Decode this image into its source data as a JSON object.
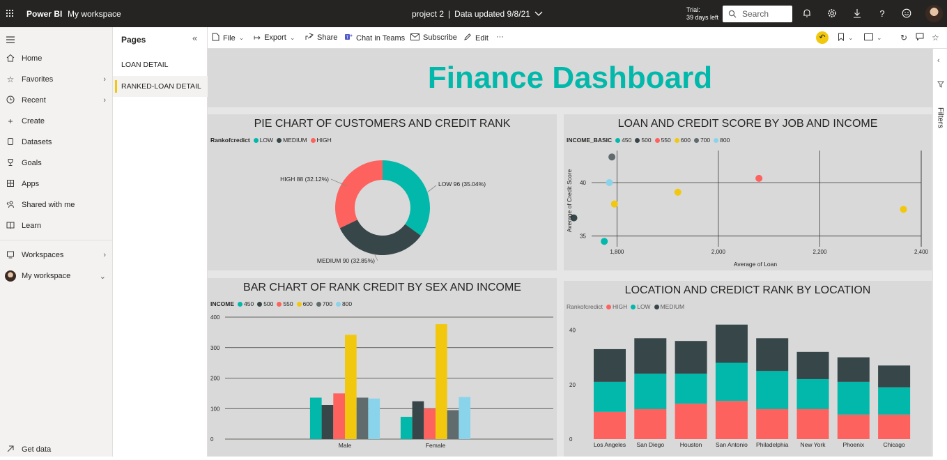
{
  "topbar": {
    "brand": "Power BI",
    "workspace": "My workspace",
    "report_name": "project 2",
    "separator": "|",
    "data_updated": "Data updated 9/8/21",
    "trial_line1": "Trial:",
    "trial_line2": "39 days left",
    "search_placeholder": "Search"
  },
  "nav": {
    "items": [
      {
        "label": "Home",
        "icon": "home-icon"
      },
      {
        "label": "Favorites",
        "icon": "star-icon"
      },
      {
        "label": "Recent",
        "icon": "clock-icon"
      },
      {
        "label": "Create",
        "icon": "plus-icon"
      },
      {
        "label": "Datasets",
        "icon": "database-icon"
      },
      {
        "label": "Goals",
        "icon": "trophy-icon"
      },
      {
        "label": "Apps",
        "icon": "apps-icon"
      },
      {
        "label": "Shared with me",
        "icon": "shared-icon"
      },
      {
        "label": "Learn",
        "icon": "book-icon"
      },
      {
        "label": "Workspaces",
        "icon": "workspaces-icon"
      },
      {
        "label": "My workspace",
        "icon": "avatar"
      },
      {
        "label": "Get data",
        "icon": "arrow-icon"
      }
    ]
  },
  "pages": {
    "title": "Pages",
    "items": [
      "LOAN DETAIL",
      "RANKED-LOAN DETAIL"
    ],
    "active_index": 1
  },
  "toolbar": {
    "file": "File",
    "export": "Export",
    "share": "Share",
    "chat": "Chat in Teams",
    "subscribe": "Subscribe",
    "edit": "Edit",
    "more": "···"
  },
  "dashboard": {
    "title": "Finance Dashboard",
    "accent": "#01b8aa"
  },
  "filters": {
    "label": "Filters"
  },
  "chart_data": [
    {
      "type": "pie",
      "title": "PIE CHART OF CUSTOMERS AND CREDIT RANK",
      "legend_title": "Rankofcredict",
      "legend_placement": "top-left",
      "slices": [
        {
          "name": "LOW",
          "value": 96,
          "percent": "35.04%",
          "label": "LOW 96 (35.04%)",
          "color": "#01b8aa"
        },
        {
          "name": "MEDIUM",
          "value": 90,
          "percent": "32.85%",
          "label": "MEDIUM 90 (32.85%)",
          "color": "#374649"
        },
        {
          "name": "HIGH",
          "value": 88,
          "percent": "32.12%",
          "label": "HIGH 88 (32.12%)",
          "color": "#fd625e"
        }
      ]
    },
    {
      "type": "scatter",
      "title": "LOAN AND CREDIT SCORE BY JOB AND INCOME",
      "legend_title": "INCOME_BASIC",
      "legend_placement": "top-left",
      "xlabel": "Average of Loan",
      "ylabel": "Average of Credit Score",
      "xlim": [
        1750,
        2400
      ],
      "ylim": [
        34,
        43
      ],
      "xticks": [
        "1,800",
        "2,000",
        "2,200",
        "2,400"
      ],
      "xtick_values": [
        1800,
        2000,
        2200,
        2400
      ],
      "yticks": [
        "35",
        "40"
      ],
      "ytick_values": [
        35,
        40
      ],
      "grid": true,
      "series": [
        {
          "name": "450",
          "color": "#01b8aa",
          "points": [
            [
              1775,
              34.5
            ]
          ]
        },
        {
          "name": "500",
          "color": "#374649",
          "points": [
            [
              1715,
              36.7
            ]
          ]
        },
        {
          "name": "550",
          "color": "#fd625e",
          "points": [
            [
              2080,
              40.4
            ]
          ]
        },
        {
          "name": "600",
          "color": "#f2c80f",
          "points": [
            [
              1795,
              38.0
            ],
            [
              1920,
              39.1
            ],
            [
              2365,
              37.5
            ]
          ]
        },
        {
          "name": "700",
          "color": "#5f6b6d",
          "points": [
            [
              1790,
              42.4
            ]
          ]
        },
        {
          "name": "800",
          "color": "#8ad4eb",
          "points": [
            [
              1785,
              40.0
            ]
          ]
        }
      ]
    },
    {
      "type": "bar",
      "title": "BAR CHART OF RANK CREDIT BY SEX AND INCOME",
      "legend_title": "INCOME",
      "legend_placement": "top-left",
      "categories": [
        "Male",
        "Female"
      ],
      "ylim": [
        0,
        400
      ],
      "yticks": [
        "0",
        "100",
        "200",
        "300",
        "400"
      ],
      "ytick_values": [
        0,
        100,
        200,
        300,
        400
      ],
      "grid": true,
      "series": [
        {
          "name": "450",
          "color": "#01b8aa",
          "values": [
            136,
            73
          ]
        },
        {
          "name": "500",
          "color": "#374649",
          "values": [
            112,
            124
          ]
        },
        {
          "name": "550",
          "color": "#fd625e",
          "values": [
            150,
            100
          ]
        },
        {
          "name": "600",
          "color": "#f2c80f",
          "values": [
            342,
            377
          ]
        },
        {
          "name": "700",
          "color": "#5f6b6d",
          "values": [
            136,
            95
          ]
        },
        {
          "name": "800",
          "color": "#8ad4eb",
          "values": [
            133,
            138
          ]
        }
      ]
    },
    {
      "type": "bar",
      "stacked": true,
      "title": "LOCATION AND CREDICT RANK BY LOCATION",
      "legend_title": "Rankofcredict",
      "legend_placement": "top-left",
      "categories": [
        "Los Angeles",
        "San Diego",
        "Houston",
        "San Antonio",
        "Philadelphia",
        "New York",
        "Phoenix",
        "Chicago"
      ],
      "ylim": [
        0,
        45
      ],
      "yticks": [
        "0",
        "20",
        "40"
      ],
      "ytick_values": [
        0,
        20,
        40
      ],
      "series": [
        {
          "name": "HIGH",
          "color": "#fd625e",
          "values": [
            10,
            11,
            13,
            14,
            11,
            11,
            9,
            9
          ]
        },
        {
          "name": "LOW",
          "color": "#01b8aa",
          "values": [
            11,
            13,
            11,
            14,
            14,
            11,
            12,
            10
          ]
        },
        {
          "name": "MEDIUM",
          "color": "#374649",
          "values": [
            12,
            13,
            12,
            14,
            12,
            10,
            9,
            8
          ]
        }
      ]
    }
  ]
}
